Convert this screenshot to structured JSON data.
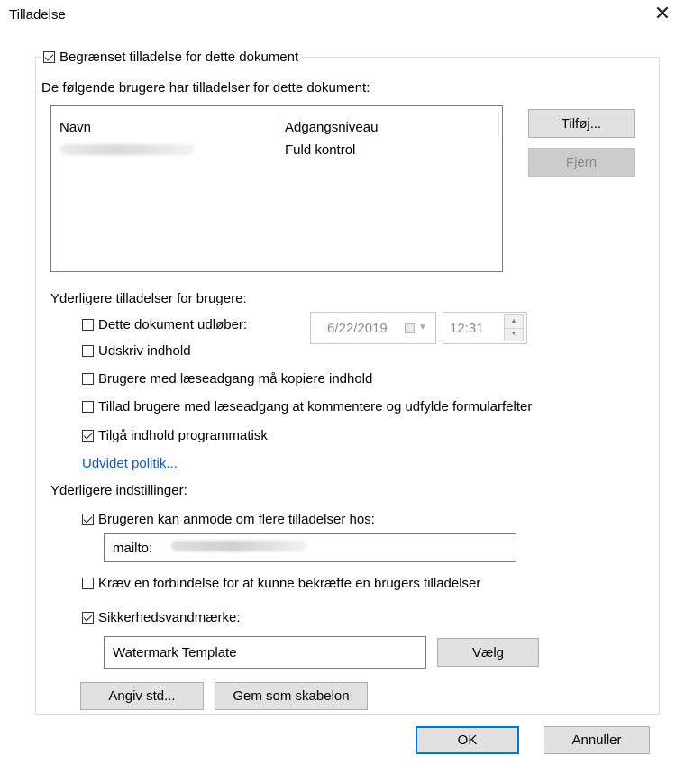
{
  "window": {
    "title": "Tilladelse",
    "close_glyph": "✕"
  },
  "restrict": {
    "label": "Begrænset tilladelse for dette dokument",
    "checked": true
  },
  "users": {
    "heading": "De følgende brugere har tilladelser for dette dokument:",
    "columns": [
      "Navn",
      "Adgangsniveau"
    ],
    "rows": [
      {
        "name": "",
        "access": "Fuld kontrol"
      }
    ],
    "add_button": "Tilføj...",
    "remove_button": "Fjern"
  },
  "additional_permissions": {
    "heading": "Yderligere tilladelser for brugere:",
    "expires": {
      "label": "Dette dokument udløber:",
      "checked": false,
      "date": "6/22/2019",
      "time": "12:31"
    },
    "print": {
      "label": "Udskriv indhold",
      "checked": false
    },
    "copy": {
      "label": "Brugere med læseadgang må kopiere indhold",
      "checked": false
    },
    "comment": {
      "label": "Tillad brugere med læseadgang at kommentere og udfylde formularfelter",
      "checked": false
    },
    "programmatic": {
      "label": "Tilgå indhold programmatisk",
      "checked": true
    },
    "policy_link": "Udvidet politik..."
  },
  "additional_settings": {
    "heading": "Yderligere indstillinger:",
    "request": {
      "label": "Brugeren kan anmode om flere tilladelser hos:",
      "checked": true,
      "value": "mailto:"
    },
    "connection": {
      "label": "Kræv en forbindelse for at kunne bekræfte en brugers tilladelser",
      "checked": false
    },
    "watermark": {
      "label": "Sikkerhedsvandmærke:",
      "checked": true,
      "value": "Watermark Template",
      "choose_button": "Vælg"
    },
    "set_default_button": "Angiv std...",
    "save_template_button": "Gem som skabelon"
  },
  "footer": {
    "ok_button": "OK",
    "cancel_button": "Annuller"
  },
  "colors": {
    "link": "#1a56b0",
    "default_button_border": "#0078d7"
  }
}
